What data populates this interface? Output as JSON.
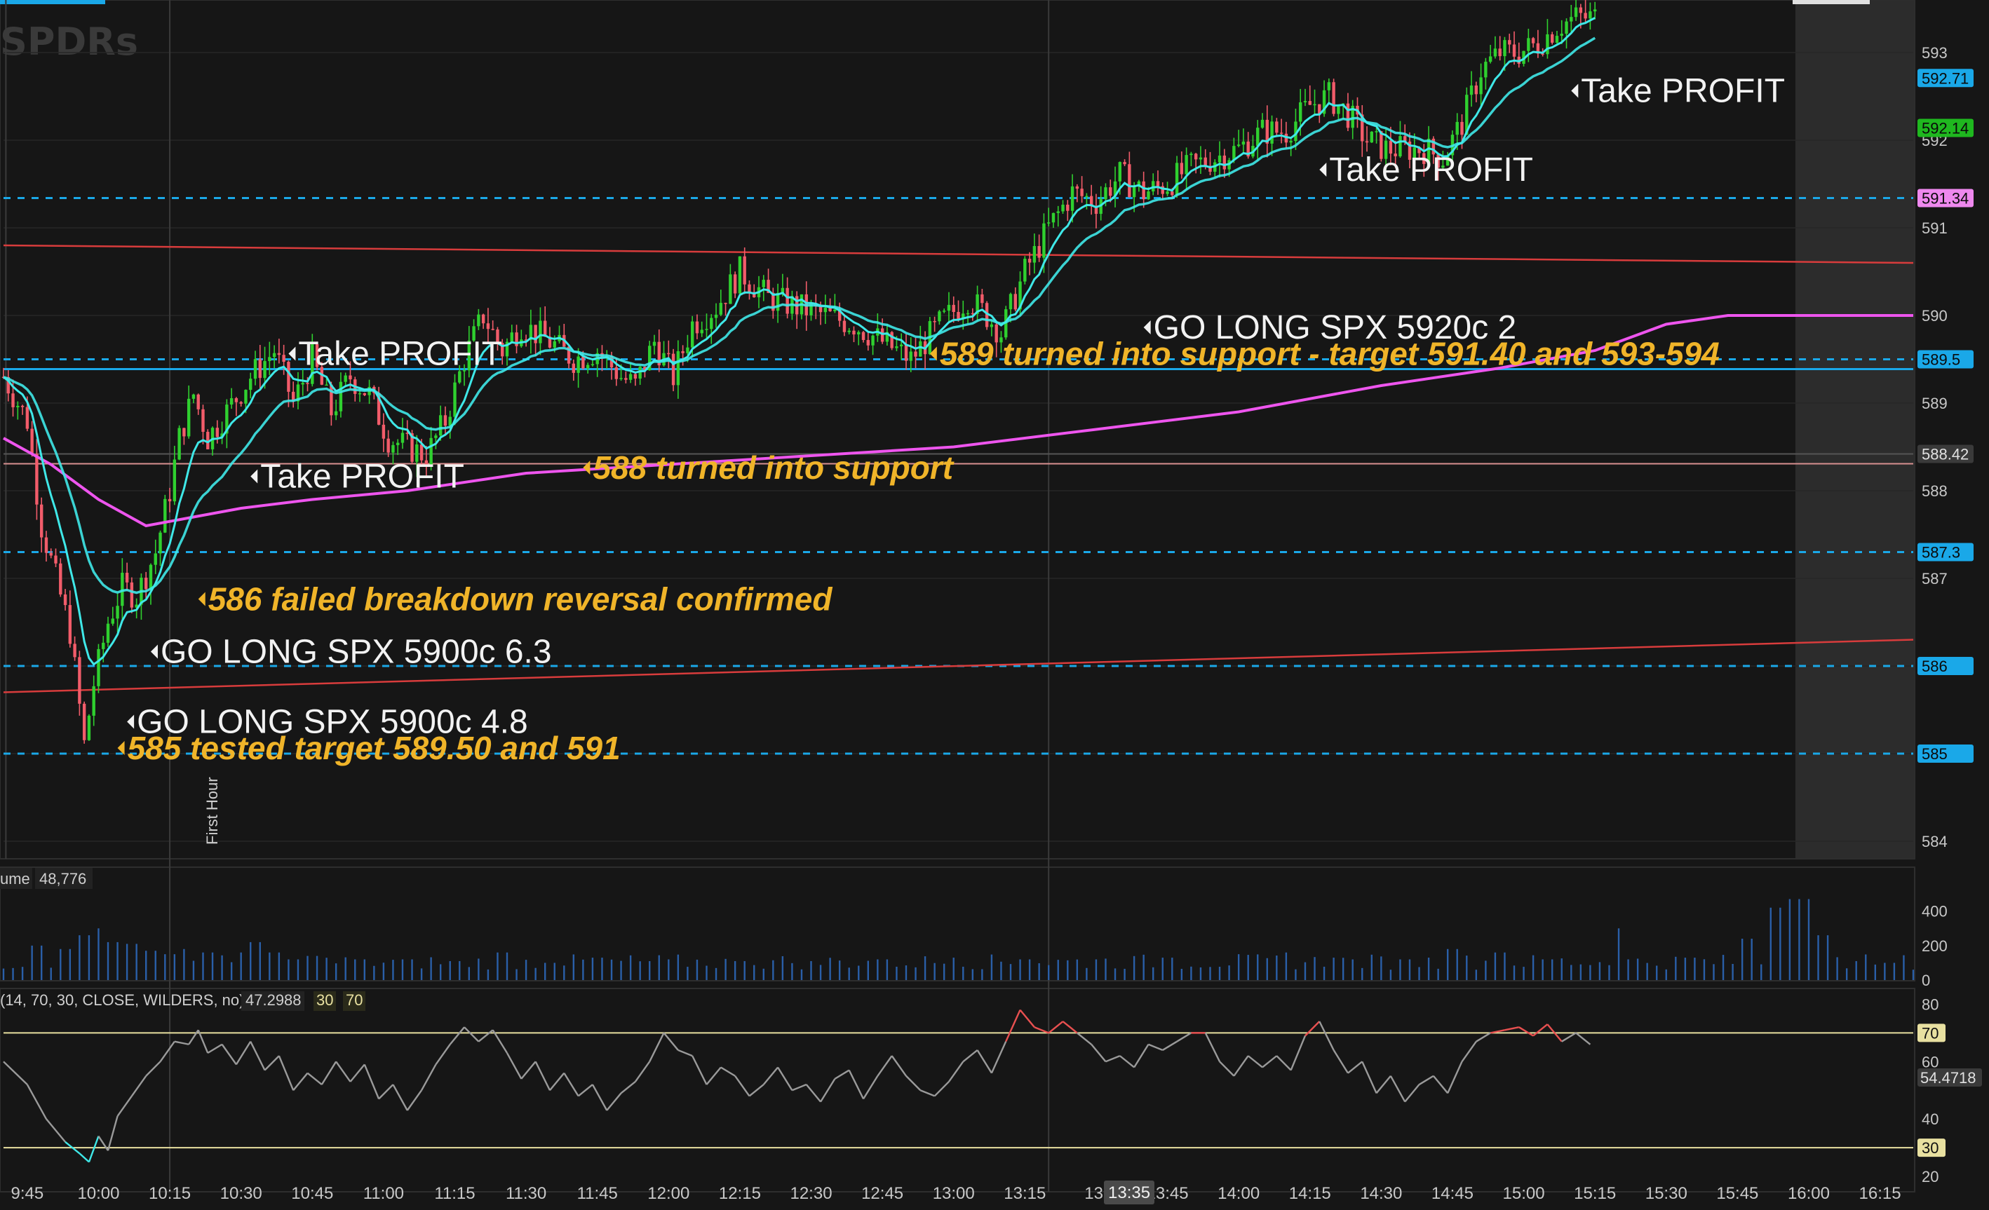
{
  "watermark": "SPDRs",
  "first_hour_label": "First Hour",
  "volume_header": {
    "label": "ume",
    "value": "48,776"
  },
  "rsi_header": {
    "label": "(14, 70, 30, CLOSE, WILDERS, no)",
    "value": "47.2988",
    "ob": "30",
    "os": "70"
  },
  "cursor_time": "13:35",
  "colors": {
    "background": "#161616",
    "candle_up": "#2fd02f",
    "candle_down": "#f25c6a",
    "ema_fast": "#3fe8e8",
    "ema_slow": "#3fe8e8",
    "vwap": "#ee55ee",
    "trendline": "#d83c3c",
    "dashed_level": "#1aa8e8",
    "annotation_white": "#f2f2f2",
    "annotation_gold": "#f0b429",
    "rsi_line": "#9a9a9a",
    "rsi_hot": "#e85050",
    "rsi_cold": "#3fe8e8",
    "rsi_band": "#e8e0a0",
    "volume_bar": "#2a5fa8"
  },
  "chart_data": [
    {
      "type": "line",
      "name": "price",
      "ylim": [
        583.8,
        593.6
      ],
      "yticks": [
        584,
        585,
        586,
        587,
        588,
        589,
        590,
        591,
        592,
        593
      ],
      "x_ticks": [
        "9:45",
        "10:00",
        "10:15",
        "10:30",
        "10:45",
        "11:00",
        "11:15",
        "11:30",
        "11:45",
        "12:00",
        "12:15",
        "12:30",
        "12:45",
        "13:00",
        "13:15",
        "13:",
        "13:45",
        "14:00",
        "14:15",
        "14:30",
        "14:45",
        "15:00",
        "15:15",
        "15:30",
        "15:45",
        "16:00",
        "16:15"
      ],
      "x_tick_minutes": [
        0,
        15,
        30,
        45,
        60,
        75,
        90,
        105,
        120,
        135,
        150,
        165,
        180,
        195,
        210,
        225,
        240,
        255,
        270,
        285,
        300,
        315,
        330,
        345,
        360,
        375,
        390
      ],
      "x_range_minutes": [
        -5,
        397
      ],
      "price_path": [
        [
          -5,
          589.3
        ],
        [
          0,
          588.8
        ],
        [
          3,
          587.6
        ],
        [
          6,
          587.0
        ],
        [
          9,
          586.4
        ],
        [
          12,
          585.1
        ],
        [
          14,
          585.8
        ],
        [
          17,
          586.5
        ],
        [
          20,
          586.9
        ],
        [
          23,
          586.8
        ],
        [
          27,
          587.3
        ],
        [
          30,
          588.0
        ],
        [
          32,
          588.6
        ],
        [
          35,
          589.1
        ],
        [
          38,
          588.6
        ],
        [
          42,
          588.9
        ],
        [
          47,
          589.3
        ],
        [
          52,
          589.6
        ],
        [
          56,
          589.0
        ],
        [
          60,
          589.5
        ],
        [
          64,
          588.9
        ],
        [
          68,
          589.3
        ],
        [
          72,
          589.1
        ],
        [
          76,
          588.6
        ],
        [
          80,
          588.5
        ],
        [
          84,
          588.4
        ],
        [
          88,
          588.8
        ],
        [
          92,
          589.5
        ],
        [
          96,
          590.0
        ],
        [
          100,
          589.6
        ],
        [
          104,
          589.9
        ],
        [
          110,
          589.7
        ],
        [
          115,
          589.5
        ],
        [
          120,
          589.6
        ],
        [
          125,
          589.3
        ],
        [
          128,
          589.2
        ],
        [
          132,
          589.7
        ],
        [
          136,
          589.3
        ],
        [
          140,
          589.9
        ],
        [
          145,
          590.1
        ],
        [
          150,
          590.5
        ],
        [
          156,
          590.2
        ],
        [
          162,
          590.1
        ],
        [
          168,
          590.0
        ],
        [
          174,
          589.9
        ],
        [
          180,
          589.7
        ],
        [
          186,
          589.5
        ],
        [
          192,
          589.9
        ],
        [
          198,
          590.2
        ],
        [
          202,
          590.0
        ],
        [
          205,
          589.8
        ],
        [
          210,
          590.5
        ],
        [
          215,
          591.0
        ],
        [
          220,
          591.4
        ],
        [
          225,
          591.3
        ],
        [
          230,
          591.6
        ],
        [
          235,
          591.4
        ],
        [
          240,
          591.5
        ],
        [
          245,
          591.7
        ],
        [
          250,
          591.8
        ],
        [
          255,
          591.9
        ],
        [
          260,
          592.1
        ],
        [
          265,
          592.1
        ],
        [
          270,
          592.4
        ],
        [
          274,
          592.5
        ],
        [
          278,
          592.3
        ],
        [
          282,
          592.0
        ],
        [
          286,
          591.9
        ],
        [
          290,
          591.9
        ],
        [
          294,
          591.9
        ],
        [
          298,
          591.8
        ],
        [
          302,
          592.2
        ],
        [
          306,
          592.8
        ],
        [
          310,
          593.0
        ],
        [
          314,
          593.0
        ],
        [
          318,
          593.1
        ],
        [
          322,
          593.3
        ],
        [
          326,
          593.4
        ],
        [
          330,
          593.4
        ]
      ],
      "vwap_path": [
        [
          -5,
          588.6
        ],
        [
          5,
          588.3
        ],
        [
          15,
          587.9
        ],
        [
          25,
          587.6
        ],
        [
          35,
          587.7
        ],
        [
          45,
          587.8
        ],
        [
          60,
          587.9
        ],
        [
          80,
          588.0
        ],
        [
          105,
          588.2
        ],
        [
          135,
          588.3
        ],
        [
          165,
          588.4
        ],
        [
          195,
          588.5
        ],
        [
          225,
          588.7
        ],
        [
          255,
          588.9
        ],
        [
          285,
          589.2
        ],
        [
          310,
          589.4
        ],
        [
          330,
          589.6
        ],
        [
          345,
          589.9
        ],
        [
          358,
          590.0
        ],
        [
          375,
          590.0
        ],
        [
          397,
          590.0
        ]
      ],
      "h_levels_dashed": [
        591.34,
        589.5,
        587.3,
        586.0,
        585.0
      ],
      "h_level_solid": 589.5,
      "h_level_gray": 588.42,
      "trendlines": [
        {
          "from": [
            -5,
            590.8
          ],
          "to": [
            397,
            590.6
          ]
        },
        {
          "from": [
            -5,
            585.7
          ],
          "to": [
            397,
            586.3
          ]
        }
      ],
      "price_tags": [
        {
          "value": 592.71,
          "text": "592.71",
          "bg": "#1aa8e8",
          "fg": "#0a0a0a"
        },
        {
          "value": 592.14,
          "text": "592.14",
          "bg": "#1fb81f",
          "fg": "#0a0a0a"
        },
        {
          "value": 591.34,
          "text": "591.34",
          "bg": "#ee88ee",
          "fg": "#0a0a0a"
        },
        {
          "value": 589.5,
          "text": "589.5",
          "bg": "#1aa8e8",
          "fg": "#0a0a0a"
        },
        {
          "value": 588.42,
          "text": "588.42",
          "bg": "#3a3a3a",
          "fg": "#e0e0e0"
        },
        {
          "value": 587.3,
          "text": "587.3",
          "bg": "#1aa8e8",
          "fg": "#0a0a0a"
        },
        {
          "value": 586.0,
          "text": "586",
          "bg": "#1aa8e8",
          "fg": "#0a0a0a"
        },
        {
          "value": 585.0,
          "text": "585",
          "bg": "#1aa8e8",
          "fg": "#0a0a0a"
        }
      ],
      "annotations": [
        {
          "text": "Take PROFIT",
          "style": "white",
          "minute": 325,
          "price": 592.5
        },
        {
          "text": "Take PROFIT",
          "style": "white",
          "minute": 272,
          "price": 591.6
        },
        {
          "text": "GO LONG SPX 5920c 2",
          "style": "white",
          "minute": 235,
          "price": 589.8
        },
        {
          "text": "589 turned into support - target 591.40 and 593-594",
          "style": "gold",
          "minute": 190,
          "price": 589.5
        },
        {
          "text": "Take PROFIT",
          "style": "white",
          "minute": 55,
          "price": 589.5
        },
        {
          "text": "Take PROFIT",
          "style": "white",
          "minute": 47,
          "price": 588.1
        },
        {
          "text": "588 turned into support",
          "style": "gold",
          "minute": 117,
          "price": 588.2
        },
        {
          "text": "586 failed breakdown reversal confirmed",
          "style": "gold",
          "minute": 36,
          "price": 586.7
        },
        {
          "text": "GO LONG SPX 5900c 6.3",
          "style": "white",
          "minute": 26,
          "price": 586.1
        },
        {
          "text": "GO LONG SPX 5900c 4.8",
          "style": "white",
          "minute": 21,
          "price": 585.3
        },
        {
          "text": "585 tested target 589.50 and 591",
          "style": "gold",
          "minute": 19,
          "price": 585.0
        }
      ]
    },
    {
      "type": "bar",
      "name": "volume",
      "ylim": [
        0,
        480
      ],
      "yticks": [
        400,
        200,
        0
      ],
      "bars": [
        [
          2,
          200
        ],
        [
          8,
          180
        ],
        [
          12,
          260
        ],
        [
          15,
          300
        ],
        [
          18,
          220
        ],
        [
          22,
          210
        ],
        [
          26,
          170
        ],
        [
          30,
          150
        ],
        [
          33,
          180
        ],
        [
          38,
          160
        ],
        [
          45,
          160
        ],
        [
          48,
          220
        ],
        [
          52,
          160
        ],
        [
          56,
          120
        ],
        [
          60,
          140
        ],
        [
          70,
          120
        ],
        [
          80,
          120
        ],
        [
          90,
          110
        ],
        [
          100,
          160
        ],
        [
          110,
          100
        ],
        [
          120,
          130
        ],
        [
          135,
          120
        ],
        [
          150,
          110
        ],
        [
          165,
          110
        ],
        [
          180,
          120
        ],
        [
          195,
          130
        ],
        [
          210,
          120
        ],
        [
          225,
          120
        ],
        [
          240,
          130
        ],
        [
          255,
          150
        ],
        [
          265,
          160
        ],
        [
          275,
          130
        ],
        [
          290,
          120
        ],
        [
          300,
          180
        ],
        [
          310,
          160
        ],
        [
          320,
          120
        ],
        [
          335,
          300
        ],
        [
          350,
          130
        ],
        [
          362,
          240
        ],
        [
          368,
          420
        ],
        [
          372,
          470
        ],
        [
          374,
          470
        ],
        [
          378,
          260
        ],
        [
          385,
          110
        ],
        [
          392,
          100
        ]
      ]
    },
    {
      "type": "line",
      "name": "RSI",
      "ylim": [
        20,
        85
      ],
      "yticks": [
        80,
        70,
        60,
        40,
        20
      ],
      "overbought": 70,
      "oversold": 30,
      "current_value": "54.4718",
      "path": [
        [
          -5,
          60
        ],
        [
          0,
          52
        ],
        [
          4,
          40
        ],
        [
          8,
          32
        ],
        [
          11,
          28
        ],
        [
          13,
          25
        ],
        [
          15,
          34
        ],
        [
          17,
          29
        ],
        [
          19,
          41
        ],
        [
          22,
          48
        ],
        [
          25,
          55
        ],
        [
          28,
          60
        ],
        [
          31,
          67
        ],
        [
          34,
          66
        ],
        [
          36,
          71
        ],
        [
          38,
          63
        ],
        [
          41,
          66
        ],
        [
          44,
          59
        ],
        [
          47,
          67
        ],
        [
          50,
          57
        ],
        [
          53,
          62
        ],
        [
          56,
          50
        ],
        [
          59,
          56
        ],
        [
          62,
          52
        ],
        [
          65,
          60
        ],
        [
          68,
          53
        ],
        [
          71,
          59
        ],
        [
          74,
          47
        ],
        [
          77,
          52
        ],
        [
          80,
          43
        ],
        [
          83,
          50
        ],
        [
          86,
          59
        ],
        [
          89,
          66
        ],
        [
          92,
          72
        ],
        [
          95,
          67
        ],
        [
          98,
          71
        ],
        [
          101,
          63
        ],
        [
          104,
          54
        ],
        [
          107,
          60
        ],
        [
          110,
          50
        ],
        [
          113,
          56
        ],
        [
          116,
          48
        ],
        [
          119,
          52
        ],
        [
          122,
          43
        ],
        [
          125,
          49
        ],
        [
          128,
          53
        ],
        [
          131,
          60
        ],
        [
          134,
          70
        ],
        [
          137,
          64
        ],
        [
          140,
          62
        ],
        [
          143,
          52
        ],
        [
          146,
          58
        ],
        [
          149,
          55
        ],
        [
          152,
          48
        ],
        [
          155,
          52
        ],
        [
          158,
          58
        ],
        [
          161,
          50
        ],
        [
          164,
          52
        ],
        [
          167,
          46
        ],
        [
          170,
          54
        ],
        [
          173,
          57
        ],
        [
          176,
          47
        ],
        [
          179,
          55
        ],
        [
          182,
          62
        ],
        [
          185,
          55
        ],
        [
          188,
          50
        ],
        [
          191,
          48
        ],
        [
          194,
          53
        ],
        [
          197,
          60
        ],
        [
          200,
          64
        ],
        [
          203,
          56
        ],
        [
          206,
          67
        ],
        [
          209,
          78
        ],
        [
          212,
          72
        ],
        [
          215,
          70
        ],
        [
          218,
          74
        ],
        [
          221,
          70
        ],
        [
          224,
          66
        ],
        [
          227,
          60
        ],
        [
          230,
          62
        ],
        [
          233,
          58
        ],
        [
          236,
          66
        ],
        [
          239,
          64
        ],
        [
          242,
          67
        ],
        [
          245,
          70
        ],
        [
          248,
          70
        ],
        [
          251,
          60
        ],
        [
          254,
          55
        ],
        [
          257,
          62
        ],
        [
          260,
          58
        ],
        [
          263,
          62
        ],
        [
          266,
          57
        ],
        [
          269,
          69
        ],
        [
          272,
          74
        ],
        [
          275,
          64
        ],
        [
          278,
          56
        ],
        [
          281,
          60
        ],
        [
          284,
          49
        ],
        [
          287,
          55
        ],
        [
          290,
          46
        ],
        [
          293,
          52
        ],
        [
          296,
          55
        ],
        [
          299,
          49
        ],
        [
          302,
          60
        ],
        [
          305,
          67
        ],
        [
          308,
          70
        ],
        [
          311,
          71
        ],
        [
          314,
          72
        ],
        [
          317,
          69
        ],
        [
          320,
          73
        ],
        [
          323,
          67
        ],
        [
          326,
          70
        ],
        [
          329,
          66
        ]
      ]
    }
  ]
}
